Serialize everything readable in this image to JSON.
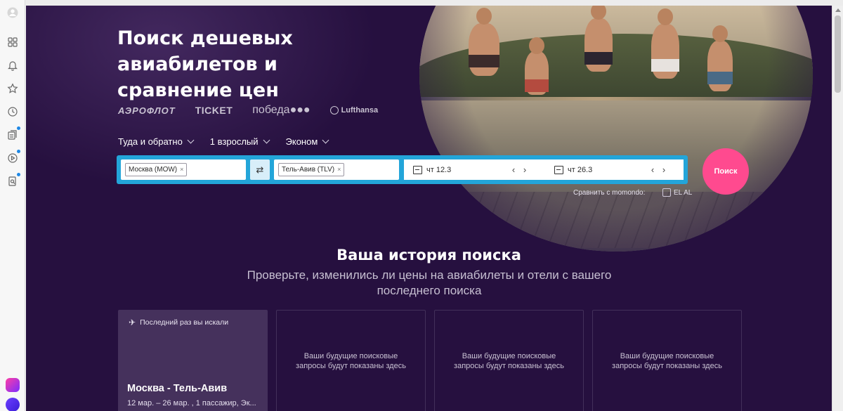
{
  "hero": {
    "title": "Поиск дешевых авиабилетов и сравнение цен",
    "logos": [
      "АЭРОФЛОТ",
      "TICKET",
      "победа●●●",
      "Lufthansa"
    ]
  },
  "search_options": {
    "trip_type": "Туда и обратно",
    "passengers": "1 взрослый",
    "cabin": "Эконом"
  },
  "search": {
    "origin": "Москва (MOW)",
    "destination": "Тель-Авив (TLV)",
    "chip_remove": "×",
    "swap_icon": "⇄",
    "depart_date": "чт 12.3",
    "return_date": "чт 26.3",
    "prev_arrow": "‹",
    "next_arrow": "›",
    "submit": "Поиск"
  },
  "compare": {
    "label": "Сравнить с momondo:",
    "option": "EL AL"
  },
  "history": {
    "title": "Ваша история поиска",
    "subtitle": "Проверьте, изменились ли цены на авиабилеты и отели с вашего последнего поиска",
    "last_label": "Последний раз вы искали",
    "last_route": "Москва - Тель-Авив",
    "last_details": "12 мар. – 26 мар. , 1 пассажир, Эк...",
    "placeholder": "Ваши будущие поисковые запросы будут показаны здесь"
  },
  "icons": {
    "rail": [
      "avatar-icon",
      "apps-grid-icon",
      "bell-icon",
      "star-icon",
      "history-icon",
      "collections-icon",
      "video-icon",
      "search-page-icon"
    ],
    "plane": "✈",
    "calendar": "calendar-icon"
  },
  "colors": {
    "page_bg": "#26103f",
    "searchbar": "#23a5d9",
    "search_button": "#ff4a8f",
    "card_active": "#45315c"
  }
}
